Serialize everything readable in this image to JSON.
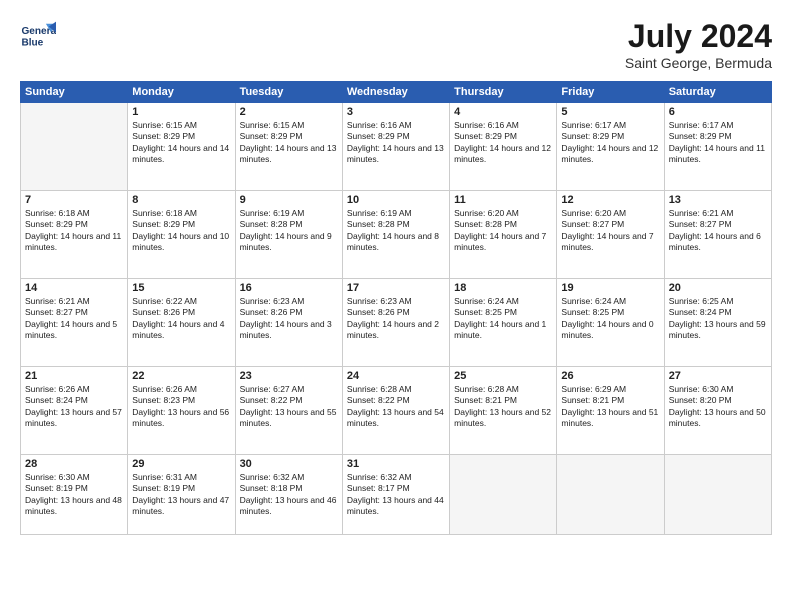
{
  "logo": {
    "line1": "General",
    "line2": "Blue"
  },
  "title": "July 2024",
  "location": "Saint George, Bermuda",
  "weekdays": [
    "Sunday",
    "Monday",
    "Tuesday",
    "Wednesday",
    "Thursday",
    "Friday",
    "Saturday"
  ],
  "weeks": [
    [
      {
        "day": "",
        "empty": true
      },
      {
        "day": "1",
        "sunrise": "6:15 AM",
        "sunset": "8:29 PM",
        "daylight": "14 hours and 14 minutes."
      },
      {
        "day": "2",
        "sunrise": "6:15 AM",
        "sunset": "8:29 PM",
        "daylight": "14 hours and 13 minutes."
      },
      {
        "day": "3",
        "sunrise": "6:16 AM",
        "sunset": "8:29 PM",
        "daylight": "14 hours and 13 minutes."
      },
      {
        "day": "4",
        "sunrise": "6:16 AM",
        "sunset": "8:29 PM",
        "daylight": "14 hours and 12 minutes."
      },
      {
        "day": "5",
        "sunrise": "6:17 AM",
        "sunset": "8:29 PM",
        "daylight": "14 hours and 12 minutes."
      },
      {
        "day": "6",
        "sunrise": "6:17 AM",
        "sunset": "8:29 PM",
        "daylight": "14 hours and 11 minutes."
      }
    ],
    [
      {
        "day": "7",
        "sunrise": "6:18 AM",
        "sunset": "8:29 PM",
        "daylight": "14 hours and 11 minutes."
      },
      {
        "day": "8",
        "sunrise": "6:18 AM",
        "sunset": "8:29 PM",
        "daylight": "14 hours and 10 minutes."
      },
      {
        "day": "9",
        "sunrise": "6:19 AM",
        "sunset": "8:28 PM",
        "daylight": "14 hours and 9 minutes."
      },
      {
        "day": "10",
        "sunrise": "6:19 AM",
        "sunset": "8:28 PM",
        "daylight": "14 hours and 8 minutes."
      },
      {
        "day": "11",
        "sunrise": "6:20 AM",
        "sunset": "8:28 PM",
        "daylight": "14 hours and 7 minutes."
      },
      {
        "day": "12",
        "sunrise": "6:20 AM",
        "sunset": "8:27 PM",
        "daylight": "14 hours and 7 minutes."
      },
      {
        "day": "13",
        "sunrise": "6:21 AM",
        "sunset": "8:27 PM",
        "daylight": "14 hours and 6 minutes."
      }
    ],
    [
      {
        "day": "14",
        "sunrise": "6:21 AM",
        "sunset": "8:27 PM",
        "daylight": "14 hours and 5 minutes."
      },
      {
        "day": "15",
        "sunrise": "6:22 AM",
        "sunset": "8:26 PM",
        "daylight": "14 hours and 4 minutes."
      },
      {
        "day": "16",
        "sunrise": "6:23 AM",
        "sunset": "8:26 PM",
        "daylight": "14 hours and 3 minutes."
      },
      {
        "day": "17",
        "sunrise": "6:23 AM",
        "sunset": "8:26 PM",
        "daylight": "14 hours and 2 minutes."
      },
      {
        "day": "18",
        "sunrise": "6:24 AM",
        "sunset": "8:25 PM",
        "daylight": "14 hours and 1 minute."
      },
      {
        "day": "19",
        "sunrise": "6:24 AM",
        "sunset": "8:25 PM",
        "daylight": "14 hours and 0 minutes."
      },
      {
        "day": "20",
        "sunrise": "6:25 AM",
        "sunset": "8:24 PM",
        "daylight": "13 hours and 59 minutes."
      }
    ],
    [
      {
        "day": "21",
        "sunrise": "6:26 AM",
        "sunset": "8:24 PM",
        "daylight": "13 hours and 57 minutes."
      },
      {
        "day": "22",
        "sunrise": "6:26 AM",
        "sunset": "8:23 PM",
        "daylight": "13 hours and 56 minutes."
      },
      {
        "day": "23",
        "sunrise": "6:27 AM",
        "sunset": "8:22 PM",
        "daylight": "13 hours and 55 minutes."
      },
      {
        "day": "24",
        "sunrise": "6:28 AM",
        "sunset": "8:22 PM",
        "daylight": "13 hours and 54 minutes."
      },
      {
        "day": "25",
        "sunrise": "6:28 AM",
        "sunset": "8:21 PM",
        "daylight": "13 hours and 52 minutes."
      },
      {
        "day": "26",
        "sunrise": "6:29 AM",
        "sunset": "8:21 PM",
        "daylight": "13 hours and 51 minutes."
      },
      {
        "day": "27",
        "sunrise": "6:30 AM",
        "sunset": "8:20 PM",
        "daylight": "13 hours and 50 minutes."
      }
    ],
    [
      {
        "day": "28",
        "sunrise": "6:30 AM",
        "sunset": "8:19 PM",
        "daylight": "13 hours and 48 minutes."
      },
      {
        "day": "29",
        "sunrise": "6:31 AM",
        "sunset": "8:19 PM",
        "daylight": "13 hours and 47 minutes."
      },
      {
        "day": "30",
        "sunrise": "6:32 AM",
        "sunset": "8:18 PM",
        "daylight": "13 hours and 46 minutes."
      },
      {
        "day": "31",
        "sunrise": "6:32 AM",
        "sunset": "8:17 PM",
        "daylight": "13 hours and 44 minutes."
      },
      {
        "day": "",
        "empty": true
      },
      {
        "day": "",
        "empty": true
      },
      {
        "day": "",
        "empty": true
      }
    ]
  ]
}
